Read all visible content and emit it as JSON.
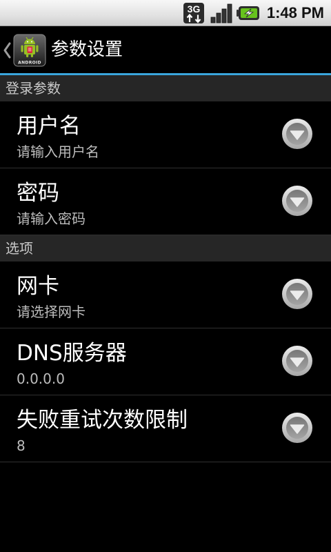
{
  "status_bar": {
    "network_type": "3G",
    "time": "1:48 PM",
    "icons": {
      "network": "3g-data-icon",
      "signal": "signal-strength-icon",
      "battery": "battery-charging-icon"
    }
  },
  "action_bar": {
    "back_icon": "chevron-left-icon",
    "app_icon": "android-app-icon",
    "app_icon_label": "ANDROID",
    "title": "参数设置"
  },
  "sections": [
    {
      "header": "登录参数",
      "items": [
        {
          "title": "用户名",
          "summary": "请输入用户名",
          "icon": "dropdown-arrow-icon"
        },
        {
          "title": "密码",
          "summary": "请输入密码",
          "icon": "dropdown-arrow-icon"
        }
      ]
    },
    {
      "header": "选项",
      "items": [
        {
          "title": "网卡",
          "summary": "请选择网卡",
          "icon": "dropdown-arrow-icon"
        },
        {
          "title": "DNS服务器",
          "summary": "0.0.0.0",
          "icon": "dropdown-arrow-icon"
        },
        {
          "title": "失败重试次数限制",
          "summary": "8",
          "icon": "dropdown-arrow-icon"
        }
      ]
    }
  ],
  "colors": {
    "status_bar_background": "#e2e2e2",
    "accent_line": "#3aa6dd",
    "section_header_background": "#262626",
    "battery_fill": "#67c21d",
    "android_green": "#97c024"
  }
}
